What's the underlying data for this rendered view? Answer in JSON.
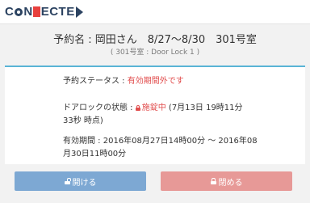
{
  "header": {
    "logo_text_1": "C",
    "logo_text_2": "N",
    "logo_text_3": "ECTE"
  },
  "reservation": {
    "title": "予約名 : 岡田さん　8/27〜8/30　301号室",
    "subtitle": "( 301号室 : Door Lock 1 )"
  },
  "details": {
    "status_label": "予約ステータス : ",
    "status_value": "有効期間外です",
    "lock_label": "ドアロックの状態 : ",
    "lock_value": "施錠中",
    "lock_time_1": " (7月13日 19時11分",
    "lock_time_2": "33秒 時点)",
    "period_label_1": "有効期間 : 2016年08月27日14時00分 〜 2016年08",
    "period_label_2": "月30日11時00分"
  },
  "buttons": {
    "open_label": "開ける",
    "close_label": "閉める"
  },
  "colors": {
    "accent": "#5ab4d6",
    "status_red": "#e14c4c",
    "open_button": "#7da8d3",
    "close_button": "#e79997",
    "logo_navy": "#2c4361",
    "logo_red": "#e8413e"
  },
  "icons": {
    "lock_status": "lock-icon",
    "open_button": "unlock-icon",
    "close_button": "lock-icon"
  }
}
